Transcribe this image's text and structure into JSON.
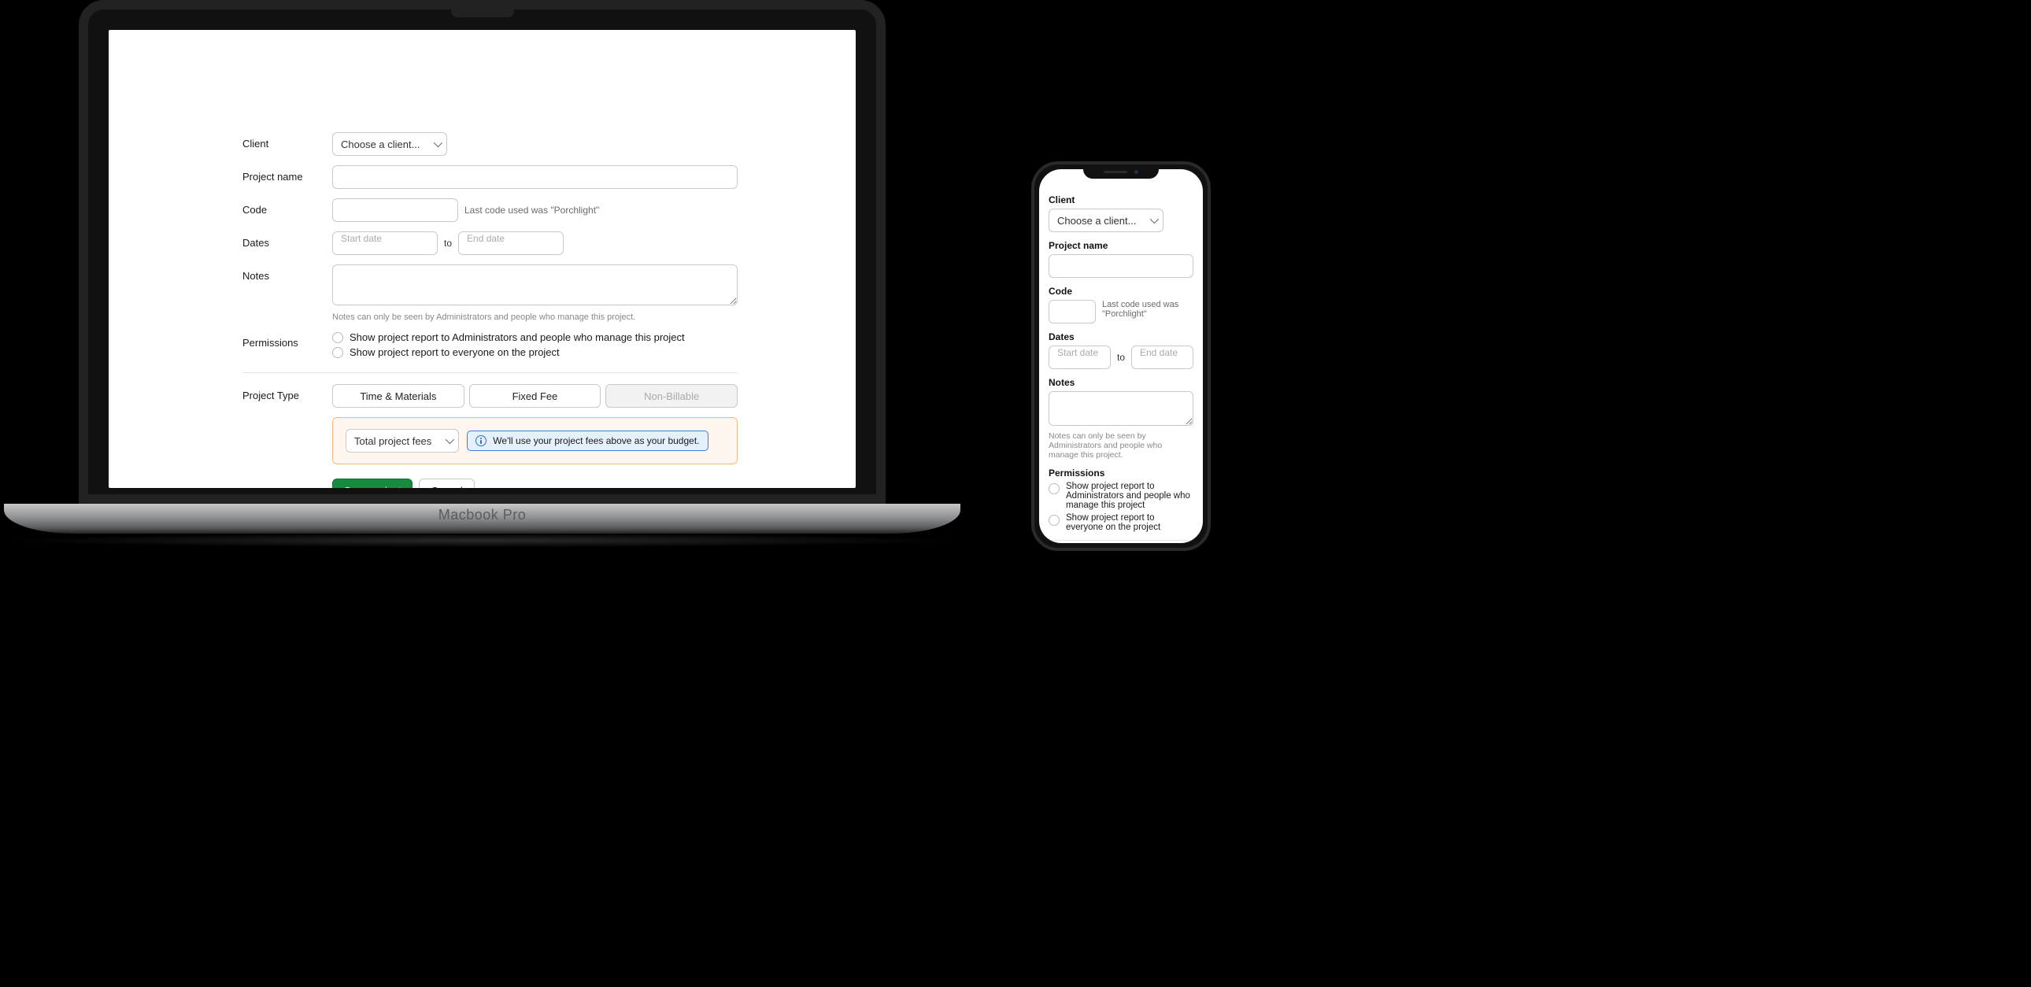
{
  "device_label": "Macbook Pro",
  "form": {
    "client": {
      "label": "Client",
      "select_text": "Choose a client..."
    },
    "project_name": {
      "label": "Project name",
      "value": ""
    },
    "code": {
      "label": "Code",
      "value": "",
      "hint": "Last code used was \"Porchlight\""
    },
    "dates": {
      "label": "Dates",
      "start_placeholder": "Start date",
      "separator": "to",
      "end_placeholder": "End date"
    },
    "notes": {
      "label": "Notes",
      "value": "",
      "helper": "Notes can only be seen by Administrators and people who manage this project."
    },
    "permissions": {
      "label": "Permissions",
      "options": [
        "Show project report to Administrators and people who manage this project",
        "Show project report to everyone on the project"
      ]
    },
    "project_type": {
      "label": "Project Type",
      "options": [
        "Time & Materials",
        "Fixed Fee",
        "Non-Billable"
      ]
    },
    "budget": {
      "select_text": "Total project fees",
      "info_text": "We'll use your project fees above as your budget."
    },
    "actions": {
      "save": "Save project",
      "cancel": "Cancel"
    }
  }
}
